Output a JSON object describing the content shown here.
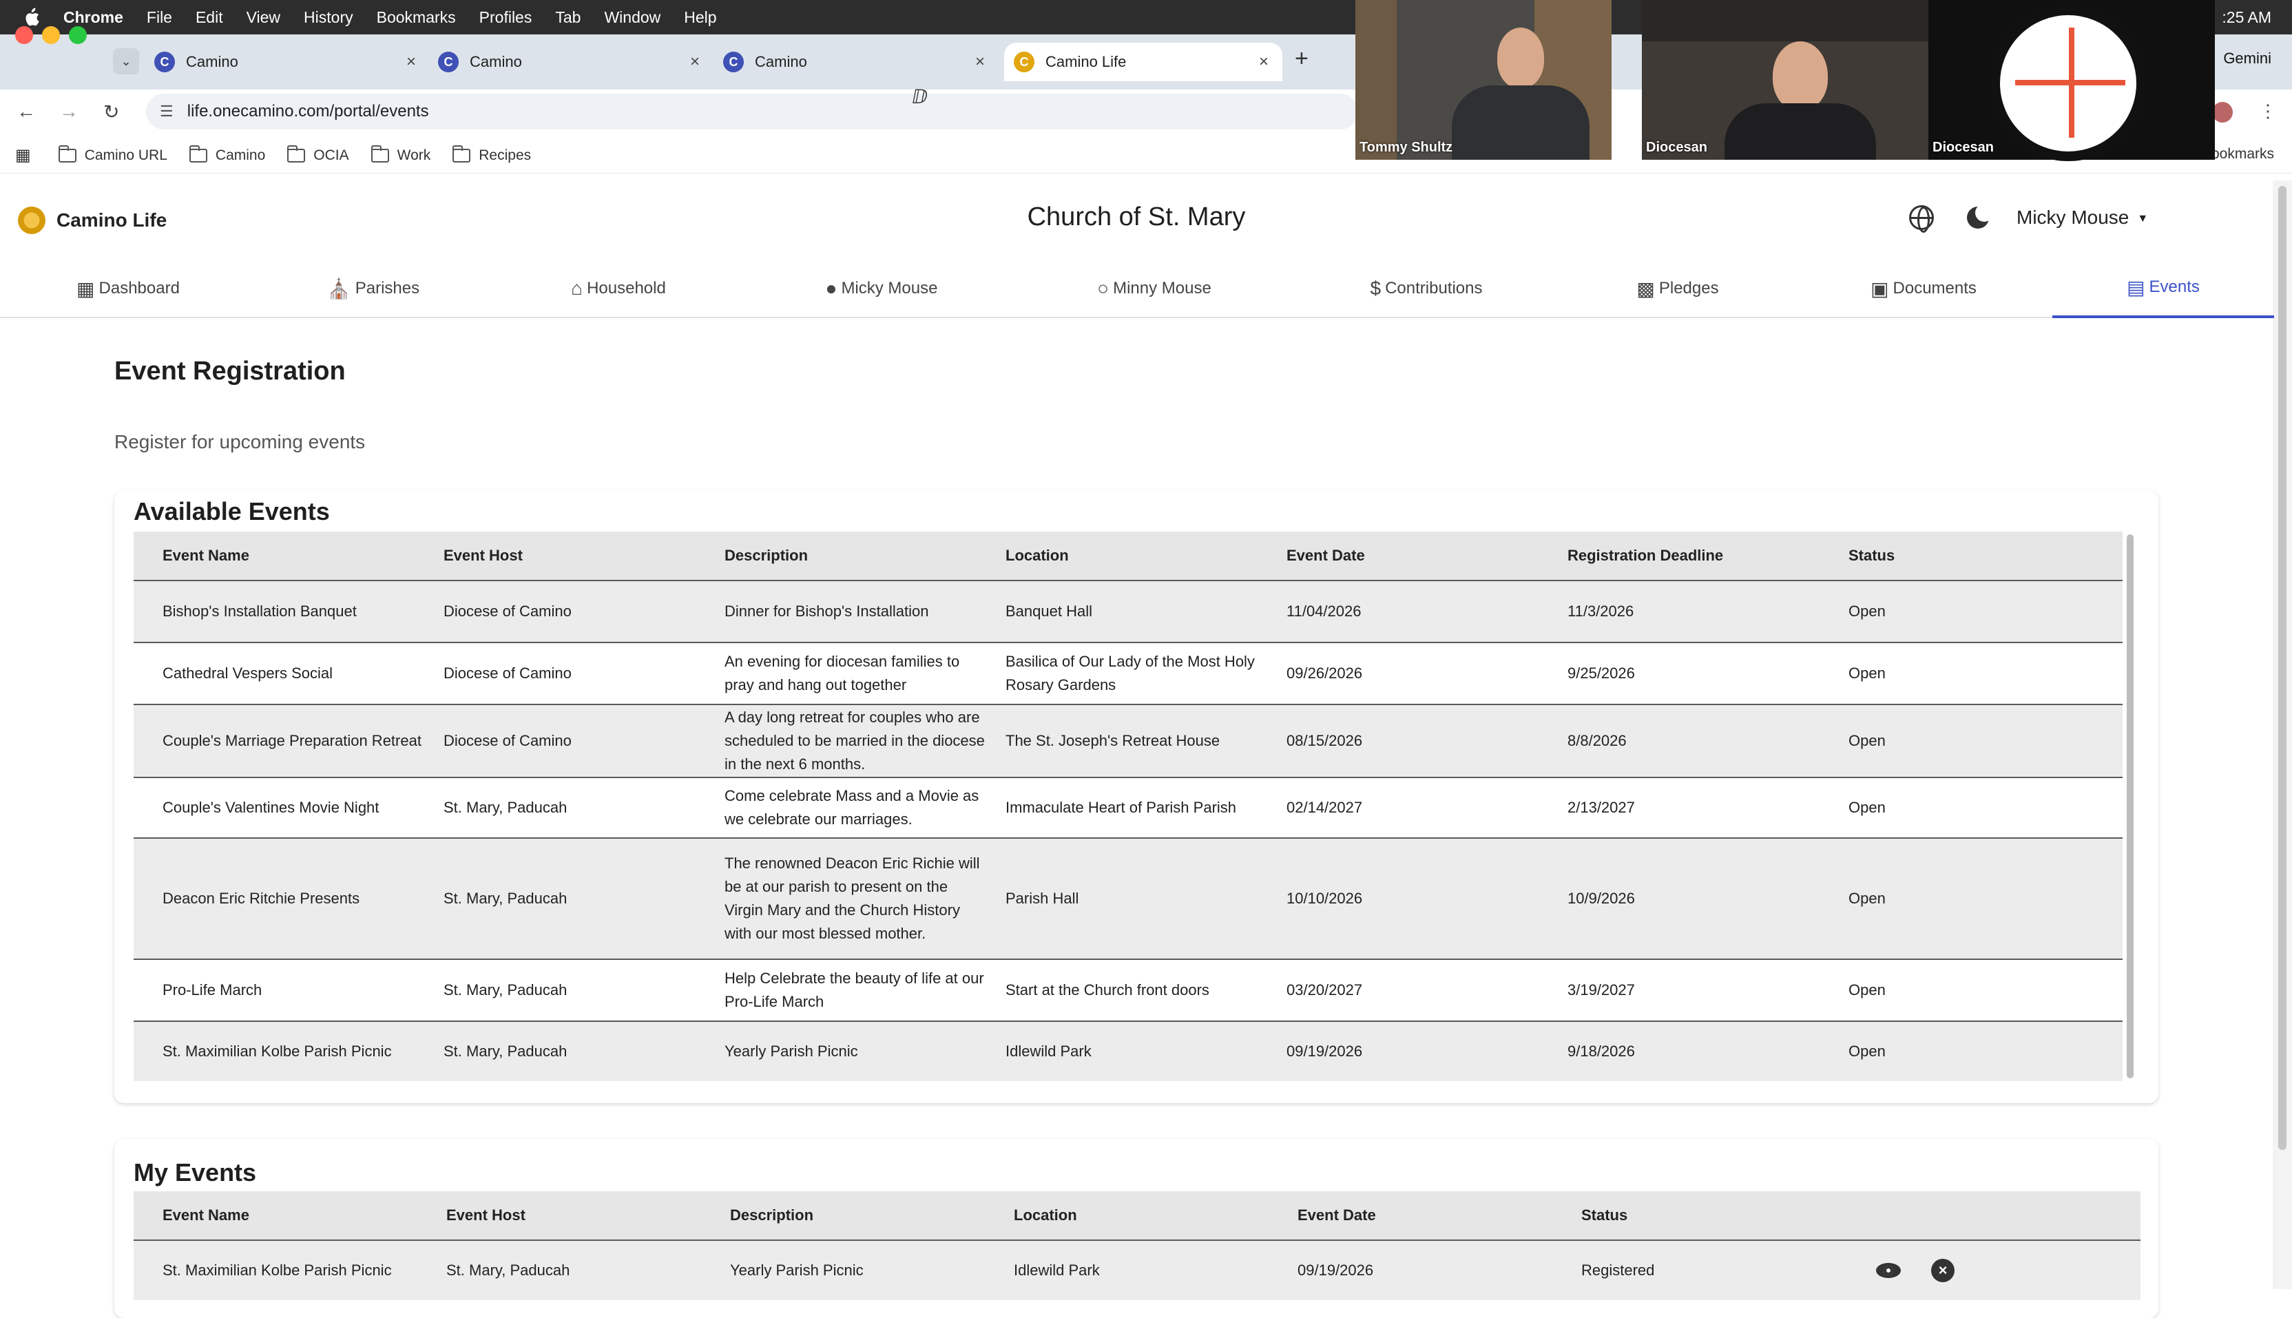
{
  "menubar": {
    "app": "Chrome",
    "items": [
      "File",
      "Edit",
      "View",
      "History",
      "Bookmarks",
      "Profiles",
      "Tab",
      "Window",
      "Help"
    ],
    "clock": ":25 AM"
  },
  "tabs": [
    {
      "title": "Camino"
    },
    {
      "title": "Camino"
    },
    {
      "title": "Camino"
    },
    {
      "title": "Camino Life"
    }
  ],
  "address": {
    "url": "life.onecamino.com/portal/events"
  },
  "bookmarks": {
    "items": [
      "Camino URL",
      "Camino",
      "OCIA",
      "Work",
      "Recipes"
    ],
    "all": "All Bookmarks"
  },
  "video": {
    "participants": [
      "Tommy Shultz",
      "Diocesan",
      "Diocesan"
    ],
    "gemini": "Gemini"
  },
  "header": {
    "brand": "Camino Life",
    "church": "Church of St. Mary",
    "user": "Micky Mouse"
  },
  "nav": [
    {
      "label": "Dashboard",
      "icon": "dashboard-icon"
    },
    {
      "label": "Parishes",
      "icon": "church-icon"
    },
    {
      "label": "Household",
      "icon": "home-icon"
    },
    {
      "label": "Micky Mouse",
      "icon": "person-icon"
    },
    {
      "label": "Minny Mouse",
      "icon": "person-outline-icon"
    },
    {
      "label": "Contributions",
      "icon": "dollar-icon"
    },
    {
      "label": "Pledges",
      "icon": "pledge-icon"
    },
    {
      "label": "Documents",
      "icon": "documents-icon"
    },
    {
      "label": "Events",
      "icon": "calendar-icon"
    }
  ],
  "page": {
    "title": "Event Registration",
    "subtitle": "Register for upcoming events"
  },
  "available": {
    "title": "Available Events",
    "columns": [
      "Event Name",
      "Event Host",
      "Description",
      "Location",
      "Event Date",
      "Registration Deadline",
      "Status"
    ],
    "rows": [
      [
        "Bishop's Installation Banquet",
        "Diocese of Camino",
        "Dinner for Bishop's Installation",
        "Banquet Hall",
        "11/04/2026",
        "11/3/2026",
        "Open"
      ],
      [
        "Cathedral Vespers Social",
        "Diocese of Camino",
        "An evening for diocesan families to pray and hang out together",
        "Basilica of Our Lady of the Most Holy Rosary Gardens",
        "09/26/2026",
        "9/25/2026",
        "Open"
      ],
      [
        "Couple's Marriage Preparation Retreat",
        "Diocese of Camino",
        "A day long retreat for couples who are scheduled to be married in the diocese in the next 6 months.",
        "The St. Joseph's Retreat House",
        "08/15/2026",
        "8/8/2026",
        "Open"
      ],
      [
        "Couple's Valentines Movie Night",
        "St. Mary, Paducah",
        "Come celebrate Mass and a Movie as we celebrate our marriages.",
        "Immaculate Heart of Parish Parish",
        "02/14/2027",
        "2/13/2027",
        "Open"
      ],
      [
        "Deacon Eric Ritchie Presents",
        "St. Mary, Paducah",
        "The renowned Deacon Eric Richie will be at our parish to present on the Virgin Mary and the Church History with our most blessed mother.",
        "Parish Hall",
        "10/10/2026",
        "10/9/2026",
        "Open"
      ],
      [
        "Pro-Life March",
        "St. Mary, Paducah",
        "Help Celebrate the beauty of life at our Pro-Life March",
        "Start at the Church front doors",
        "03/20/2027",
        "3/19/2027",
        "Open"
      ],
      [
        "St. Maximilian Kolbe Parish Picnic",
        "St. Mary, Paducah",
        "Yearly Parish Picnic",
        "Idlewild Park",
        "09/19/2026",
        "9/18/2026",
        "Open"
      ]
    ]
  },
  "my": {
    "title": "My Events",
    "columns": [
      "Event Name",
      "Event Host",
      "Description",
      "Location",
      "Event Date",
      "Status"
    ],
    "rows": [
      [
        "St. Maximilian Kolbe Parish Picnic",
        "St. Mary, Paducah",
        "Yearly Parish Picnic",
        "Idlewild Park",
        "09/19/2026",
        "Registered"
      ]
    ]
  },
  "colors": {
    "accent": "#3c52c9",
    "brand": "#e2a70e"
  }
}
